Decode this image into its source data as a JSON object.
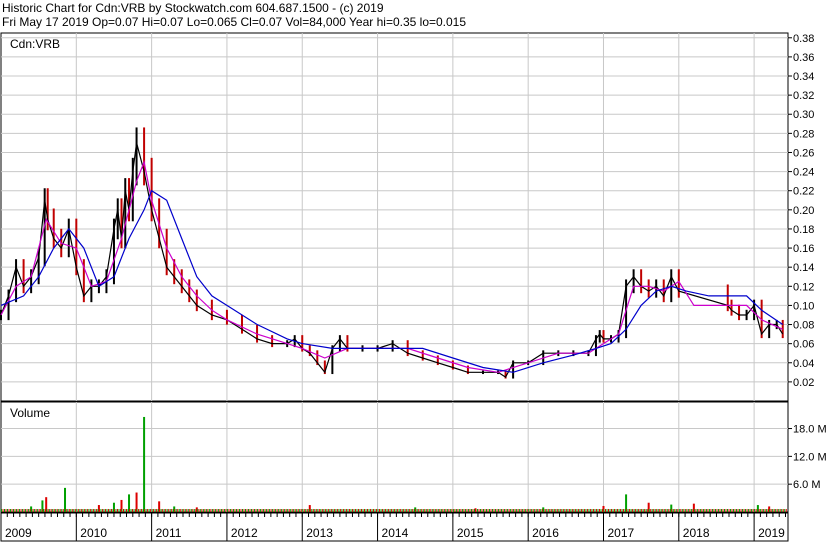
{
  "header": {
    "line1": "Historic Chart for Cdn:VRB by Stockwatch.com 604.687.1500 - (c) 2019",
    "line2": "Fri May 17 2019  Op=0.07  Hi=0.07  Lo=0.065  Cl=0.07  Vol=84,000  Year hi=0.35  lo=0.015"
  },
  "colors": {
    "price_bar": "#000000",
    "down_bar": "#c00000",
    "ma_short": "#cc00cc",
    "ma_long": "#0000cc",
    "vol_up": "#00a000",
    "vol_down": "#dd0000",
    "grid": "#c8c8c8"
  },
  "chart_data": [
    {
      "type": "line",
      "panel": "price",
      "title": "Cdn:VRB",
      "y_ticks": [
        "0.38",
        "0.36",
        "0.34",
        "0.32",
        "0.30",
        "0.28",
        "0.26",
        "0.24",
        "0.22",
        "0.20",
        "0.18",
        "0.16",
        "0.14",
        "0.12",
        "0.10",
        "0.08",
        "0.06",
        "0.04",
        "0.02"
      ],
      "ylim": [
        0.0,
        0.385
      ],
      "x_ticks": [
        "2009",
        "2010",
        "2011",
        "2012",
        "2013",
        "2014",
        "2015",
        "2016",
        "2017",
        "2018",
        "2019"
      ],
      "xlim": [
        2009.0,
        2019.45
      ],
      "grid": true,
      "series": [
        {
          "role": "price",
          "x": [
            2009.0,
            2009.1,
            2009.2,
            2009.3,
            2009.4,
            2009.5,
            2009.58,
            2009.62,
            2009.7,
            2009.8,
            2009.9,
            2010.0,
            2010.1,
            2010.2,
            2010.3,
            2010.4,
            2010.5,
            2010.55,
            2010.6,
            2010.65,
            2010.7,
            2010.75,
            2010.8,
            2010.9,
            2011.0,
            2011.1,
            2011.2,
            2011.3,
            2011.4,
            2011.5,
            2011.6,
            2011.8,
            2012.0,
            2012.2,
            2012.4,
            2012.6,
            2012.8,
            2012.9,
            2013.0,
            2013.1,
            2013.2,
            2013.3,
            2013.4,
            2013.5,
            2013.6,
            2013.8,
            2014.0,
            2014.2,
            2014.4,
            2014.6,
            2014.8,
            2015.0,
            2015.2,
            2015.4,
            2015.6,
            2015.7,
            2015.8,
            2016.0,
            2016.2,
            2016.4,
            2016.6,
            2016.8,
            2016.9,
            2016.95,
            2017.0,
            2017.1,
            2017.2,
            2017.3,
            2017.4,
            2017.5,
            2017.6,
            2017.7,
            2017.8,
            2017.9,
            2018.0,
            2018.65,
            2018.7,
            2018.8,
            2018.9,
            2019.0,
            2019.1,
            2019.2,
            2019.3,
            2019.38
          ],
          "y": [
            0.09,
            0.11,
            0.14,
            0.12,
            0.13,
            0.15,
            0.21,
            0.19,
            0.17,
            0.16,
            0.18,
            0.14,
            0.11,
            0.12,
            0.12,
            0.13,
            0.18,
            0.2,
            0.17,
            0.22,
            0.2,
            0.24,
            0.27,
            0.24,
            0.2,
            0.17,
            0.14,
            0.13,
            0.12,
            0.11,
            0.1,
            0.09,
            0.085,
            0.075,
            0.065,
            0.06,
            0.06,
            0.065,
            0.055,
            0.05,
            0.04,
            0.03,
            0.055,
            0.065,
            0.055,
            0.055,
            0.055,
            0.06,
            0.05,
            0.045,
            0.04,
            0.035,
            0.03,
            0.03,
            0.03,
            0.025,
            0.04,
            0.04,
            0.05,
            0.05,
            0.05,
            0.05,
            0.065,
            0.07,
            0.065,
            0.065,
            0.07,
            0.12,
            0.13,
            0.12,
            0.115,
            0.12,
            0.11,
            0.13,
            0.115,
            0.1,
            0.095,
            0.09,
            0.09,
            0.1,
            0.07,
            0.08,
            0.08,
            0.07
          ]
        },
        {
          "role": "short moving average",
          "x": [
            2009.0,
            2009.2,
            2009.4,
            2009.6,
            2009.8,
            2010.0,
            2010.2,
            2010.4,
            2010.6,
            2010.8,
            2010.9,
            2011.0,
            2011.2,
            2011.4,
            2011.6,
            2011.8,
            2012.0,
            2012.4,
            2012.8,
            2013.0,
            2013.3,
            2013.6,
            2014.0,
            2014.4,
            2014.8,
            2015.2,
            2015.6,
            2016.0,
            2016.4,
            2016.8,
            2017.0,
            2017.2,
            2017.4,
            2017.6,
            2017.8,
            2018.0,
            2018.2,
            2018.65,
            2018.9,
            2019.1,
            2019.38
          ],
          "y": [
            0.09,
            0.12,
            0.13,
            0.19,
            0.165,
            0.16,
            0.12,
            0.125,
            0.17,
            0.23,
            0.25,
            0.21,
            0.16,
            0.13,
            0.11,
            0.095,
            0.085,
            0.07,
            0.06,
            0.055,
            0.045,
            0.055,
            0.055,
            0.055,
            0.045,
            0.035,
            0.03,
            0.04,
            0.05,
            0.05,
            0.06,
            0.07,
            0.12,
            0.12,
            0.115,
            0.125,
            0.1,
            0.1,
            0.1,
            0.085,
            0.075
          ]
        },
        {
          "role": "long moving average",
          "x": [
            2009.0,
            2009.3,
            2009.5,
            2009.7,
            2009.9,
            2010.1,
            2010.3,
            2010.5,
            2010.7,
            2010.9,
            2011.0,
            2011.2,
            2011.4,
            2011.6,
            2011.8,
            2012.0,
            2012.4,
            2012.8,
            2013.0,
            2013.4,
            2013.8,
            2014.2,
            2014.6,
            2015.0,
            2015.4,
            2015.8,
            2016.2,
            2016.6,
            2016.9,
            2017.1,
            2017.3,
            2017.5,
            2017.7,
            2017.9,
            2018.1,
            2018.4,
            2018.65,
            2018.9,
            2019.1,
            2019.38
          ],
          "y": [
            0.1,
            0.11,
            0.13,
            0.16,
            0.18,
            0.16,
            0.12,
            0.13,
            0.17,
            0.2,
            0.22,
            0.21,
            0.17,
            0.13,
            0.11,
            0.1,
            0.08,
            0.065,
            0.06,
            0.055,
            0.055,
            0.055,
            0.055,
            0.045,
            0.035,
            0.03,
            0.04,
            0.048,
            0.055,
            0.06,
            0.075,
            0.1,
            0.115,
            0.12,
            0.115,
            0.11,
            0.11,
            0.11,
            0.095,
            0.08
          ]
        }
      ]
    },
    {
      "type": "bar",
      "panel": "volume",
      "title": "Volume",
      "y_ticks": [
        "18.0 M",
        "12.0 M",
        "6.0 M"
      ],
      "ylim": [
        0,
        22
      ],
      "x": [
        2009.4,
        2009.55,
        2009.6,
        2009.85,
        2010.3,
        2010.5,
        2010.6,
        2010.7,
        2010.8,
        2010.9,
        2011.1,
        2011.3,
        2011.6,
        2013.1,
        2014.5,
        2015.3,
        2016.2,
        2017.0,
        2017.3,
        2017.6,
        2017.9,
        2018.2,
        2019.05,
        2019.2
      ],
      "values": [
        1.2,
        2.5,
        3.2,
        5.2,
        1.5,
        2.0,
        2.6,
        3.8,
        4.2,
        20.5,
        2.3,
        1.2,
        1.0,
        1.5,
        1.0,
        0.8,
        1.0,
        1.3,
        3.8,
        2.0,
        1.6,
        1.8,
        1.5,
        1.2
      ],
      "up": [
        true,
        true,
        false,
        true,
        false,
        true,
        false,
        true,
        false,
        true,
        false,
        true,
        false,
        false,
        true,
        false,
        true,
        false,
        true,
        false,
        true,
        false,
        true,
        false
      ]
    }
  ]
}
